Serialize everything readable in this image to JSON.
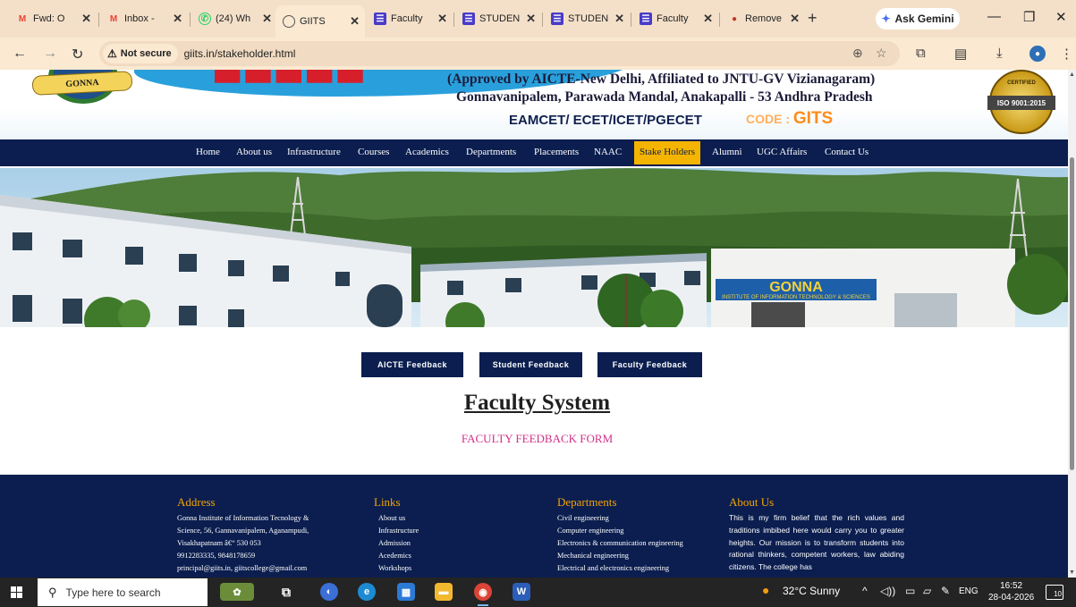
{
  "browser": {
    "tabs": [
      {
        "title": "Fwd: O",
        "favicon": "gmail-icon"
      },
      {
        "title": "Inbox -",
        "favicon": "gmail-icon"
      },
      {
        "title": "(24) Wh",
        "favicon": "whatsapp-icon"
      },
      {
        "title": "GIITS",
        "favicon": "globe-icon",
        "active": true
      },
      {
        "title": "Faculty",
        "favicon": "forms-icon"
      },
      {
        "title": "STUDEN",
        "favicon": "forms-icon"
      },
      {
        "title": "STUDEN",
        "favicon": "forms-icon"
      },
      {
        "title": "Faculty",
        "favicon": "forms-icon"
      },
      {
        "title": "Remove",
        "favicon": "remove-bg-icon"
      }
    ],
    "new_tab": "+",
    "gemini_label": "Ask Gemini",
    "security_label": "Not secure",
    "url": "giits.in/stakeholder.html"
  },
  "site": {
    "logo_text": "GONNA",
    "header_line1": "(Approved by AICTE-New Delhi, Affiliated to JNTU-GV Vizianagaram)",
    "header_line2": "Gonnavanipalem, Parawada Mandal, Anakapalli - 53 Andhra Pradesh",
    "exams": "EAMCET/ ECET/ICET/PGECET",
    "code_label": "CODE : ",
    "code_value": "GITS",
    "iso_top": "CERTIFIED",
    "iso_text": "ISO 9001:2015",
    "nav": [
      "Home",
      "About us",
      "Infrastructure",
      "Courses",
      "Academics",
      "Departments",
      "Placements",
      "NAAC",
      "Stake Holders",
      "Alumni",
      "UGC Affairs",
      "Contact Us"
    ],
    "nav_active": "Stake Holders",
    "hero_sign": "GONNA",
    "hero_sign_sub": "INSTITUTE OF INFORMATION TECHNOLOGY & SCIENCES",
    "feedback_buttons": [
      "AICTE Feedback",
      "Student Feedback",
      "Faculty Feedback"
    ],
    "page_title": "Faculty System",
    "page_subtitle": "FACULTY FEEDBACK FORM"
  },
  "footer": {
    "address_head": "Address",
    "address_lines": [
      "Gonna Institute of Information Tecnology &",
      "Science, 56, Gannavanipalem, Aganampudi,",
      "Visakhapatnam â€“ 530 053",
      "9912283335, 9848178659",
      "principal@giits.in,  giitscollege@gmail.com"
    ],
    "links_head": "Links",
    "links": [
      "About us",
      "Infrastructure",
      "Admission",
      "Acedemics",
      "Workshops"
    ],
    "departments_head": "Departments",
    "departments": [
      "Civil engineering",
      "Computer engineering",
      "Electronics & communication engineering",
      "Mechanical engineering",
      "Electrical and electronics engineering"
    ],
    "about_head": "About Us",
    "about_text": "This is my firm belief that the rich values and traditions imbibed here would carry you to greater heights. Our mission is to transform students into rational thinkers, competent workers, law abiding citizens. The college has"
  },
  "taskbar": {
    "search_placeholder": "Type here to search",
    "weather": "32°C  Sunny",
    "language": "ENG",
    "time": "16:52",
    "date": "28-04-2026",
    "notification_count": "10"
  }
}
